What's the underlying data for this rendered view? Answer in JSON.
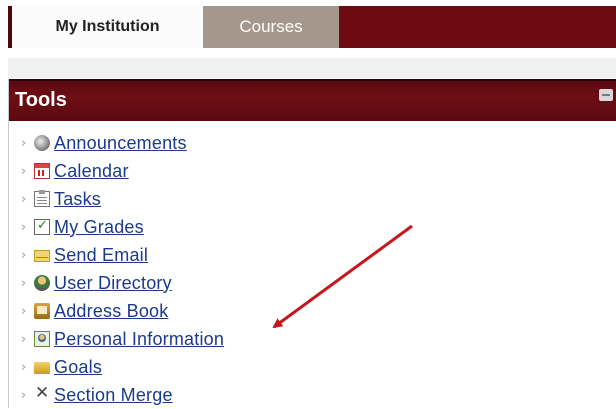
{
  "tabs": [
    {
      "label": "My Institution"
    },
    {
      "label": "Courses"
    }
  ],
  "panel": {
    "title": "Tools"
  },
  "tools": [
    {
      "label": "Announcements",
      "icon": "announcements-icon"
    },
    {
      "label": "Calendar",
      "icon": "calendar-icon"
    },
    {
      "label": "Tasks",
      "icon": "tasks-icon"
    },
    {
      "label": "My Grades",
      "icon": "grades-icon"
    },
    {
      "label": "Send Email",
      "icon": "email-icon"
    },
    {
      "label": "User Directory",
      "icon": "user-directory-icon"
    },
    {
      "label": "Address Book",
      "icon": "address-book-icon"
    },
    {
      "label": "Personal Information",
      "icon": "personal-information-icon"
    },
    {
      "label": "Goals",
      "icon": "goals-icon"
    },
    {
      "label": "Section Merge",
      "icon": "section-merge-icon"
    }
  ],
  "colors": {
    "brand": "#6e0b12",
    "link": "#1a3a8a",
    "annotation_arrow": "#c4161c"
  }
}
